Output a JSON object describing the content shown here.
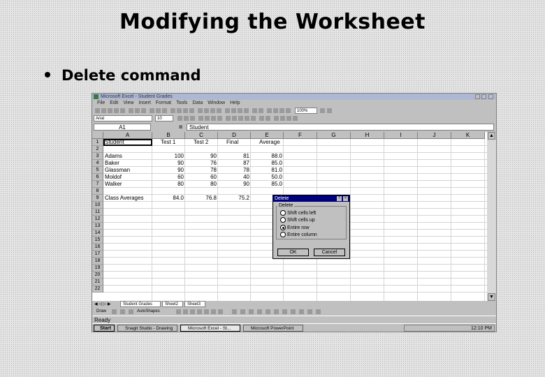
{
  "slide": {
    "title": "Modifying the Worksheet",
    "bullet": "Delete command"
  },
  "excel": {
    "title": "Microsoft Excel - Student Grades",
    "menu": [
      "File",
      "Edit",
      "View",
      "Insert",
      "Format",
      "Tools",
      "Data",
      "Window",
      "Help"
    ],
    "font_name": "Arial",
    "font_size": "10",
    "zoom": "100%",
    "name_box": "A1",
    "formula_sign": "=",
    "formula_value": "Student",
    "columns": [
      "A",
      "B",
      "C",
      "D",
      "E",
      "F",
      "G",
      "H",
      "I",
      "J",
      "K"
    ],
    "rows": [
      "1",
      "2",
      "3",
      "4",
      "5",
      "6",
      "7",
      "8",
      "9",
      "10",
      "11",
      "12",
      "13",
      "14",
      "15",
      "16",
      "17",
      "18",
      "19",
      "20",
      "21",
      "22"
    ],
    "cells": {
      "A1": "Student",
      "B1": "Test 1",
      "C1": "Test 2",
      "D1": "Final",
      "E1": "Average",
      "A3": "Adams",
      "B3": "100",
      "C3": "90",
      "D3": "81",
      "E3": "88.0",
      "A4": "Baker",
      "B4": "90",
      "C4": "76",
      "D4": "87",
      "E4": "85.0",
      "A5": "Glassman",
      "B5": "90",
      "C5": "78",
      "D5": "78",
      "E5": "81.0",
      "A6": "Moldof",
      "B6": "60",
      "C6": "60",
      "D6": "40",
      "E6": "50.0",
      "A7": "Walker",
      "B7": "80",
      "C7": "80",
      "D7": "90",
      "E7": "85.0",
      "A9": "Class Averages",
      "B9": "84.0",
      "C9": "76.8",
      "D9": "75.2"
    },
    "sheet_tabs": [
      "Student Grades",
      "Sheet2",
      "Sheet3"
    ],
    "draw_label": "Draw",
    "autoshapes_label": "AutoShapes",
    "status": "Ready",
    "taskbar": {
      "start": "Start",
      "tasks": [
        "Snagit Studio - Drawing",
        "Microsoft Excel - St...",
        "Microsoft PowerPoint"
      ],
      "clock": "12:10 PM"
    }
  },
  "dialog": {
    "title": "Delete",
    "help_glyph": "?",
    "close_glyph": "×",
    "group_label": "Delete",
    "options": [
      "Shift cells left",
      "Shift cells up",
      "Entire row",
      "Entire column"
    ],
    "selected_index": 2,
    "ok": "OK",
    "cancel": "Cancel"
  }
}
